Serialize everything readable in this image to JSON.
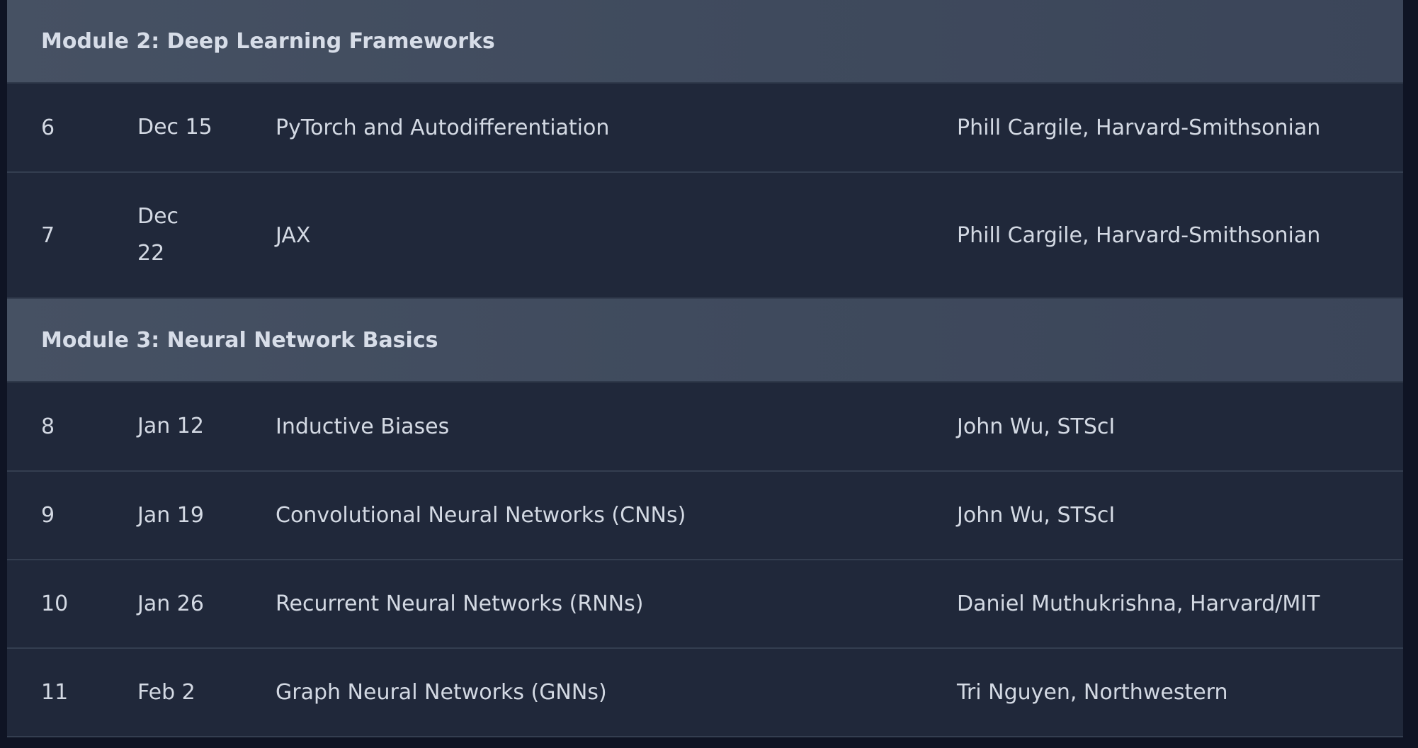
{
  "schedule": {
    "modules": [
      {
        "title": "Module 2: Deep Learning Frameworks",
        "sessions": [
          {
            "num": "6",
            "date": "Dec 15",
            "topic": "PyTorch and Autodifferentiation",
            "speaker": "Phill Cargile, Harvard-Smithsonian"
          },
          {
            "num": "7",
            "date": "Dec 22",
            "topic": "JAX",
            "speaker": "Phill Cargile, Harvard-Smithsonian"
          }
        ]
      },
      {
        "title": "Module 3: Neural Network Basics",
        "sessions": [
          {
            "num": "8",
            "date": "Jan 12",
            "topic": "Inductive Biases",
            "speaker": "John Wu, STScI"
          },
          {
            "num": "9",
            "date": "Jan 19",
            "topic": "Convolutional Neural Networks (CNNs)",
            "speaker": "John Wu, STScI"
          },
          {
            "num": "10",
            "date": "Jan 26",
            "topic": "Recurrent Neural Networks (RNNs)",
            "speaker": "Daniel Muthukrishna, Harvard/MIT"
          },
          {
            "num": "11",
            "date": "Feb 2",
            "topic": "Graph Neural Networks (GNNs)",
            "speaker": "Tri Nguyen, Northwestern"
          }
        ]
      }
    ]
  }
}
